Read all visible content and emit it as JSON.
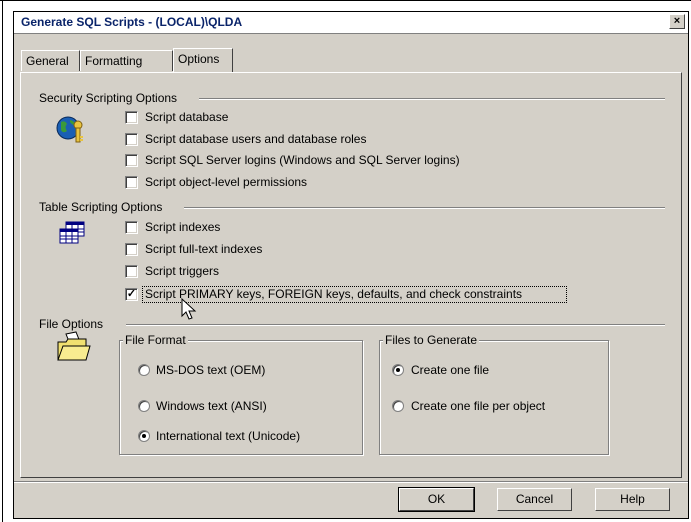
{
  "window": {
    "title": "Generate SQL Scripts - (LOCAL)\\QLDA",
    "close_glyph": "×"
  },
  "tabs": [
    {
      "label": "General"
    },
    {
      "label": "Formatting"
    },
    {
      "label": "Options",
      "active": true
    }
  ],
  "security": {
    "heading": "Security Scripting Options",
    "options": [
      {
        "label": "Script database",
        "checked": false
      },
      {
        "label": "Script database users and database roles",
        "checked": false
      },
      {
        "label": "Script SQL Server logins (Windows and SQL Server logins)",
        "checked": false
      },
      {
        "label": "Script object-level permissions",
        "checked": false
      }
    ]
  },
  "table": {
    "heading": "Table Scripting Options",
    "options": [
      {
        "label": "Script indexes",
        "checked": false
      },
      {
        "label": "Script full-text indexes",
        "checked": false
      },
      {
        "label": "Script triggers",
        "checked": false
      },
      {
        "label": "Script PRIMARY keys, FOREIGN keys, defaults, and check constraints",
        "checked": true
      }
    ]
  },
  "file": {
    "heading": "File Options",
    "format_group": {
      "title": "File Format",
      "options": [
        {
          "label": "MS-DOS text (OEM)",
          "selected": false
        },
        {
          "label": "Windows text (ANSI)",
          "selected": false
        },
        {
          "label": "International text (Unicode)",
          "selected": true
        }
      ]
    },
    "generate_group": {
      "title": "Files to Generate",
      "options": [
        {
          "label": "Create one file",
          "selected": true
        },
        {
          "label": "Create one file per object",
          "selected": false
        }
      ]
    }
  },
  "buttons": {
    "ok": "OK",
    "cancel": "Cancel",
    "help": "Help"
  },
  "check_glyph": "✓"
}
